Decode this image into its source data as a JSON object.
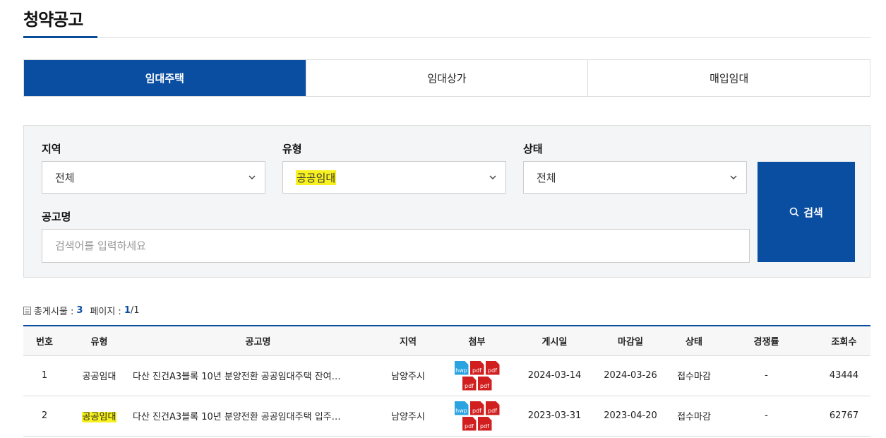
{
  "page": {
    "title": "청약공고"
  },
  "tabs": [
    {
      "label": "임대주택",
      "active": true
    },
    {
      "label": "임대상가",
      "active": false
    },
    {
      "label": "매입임대",
      "active": false
    }
  ],
  "filters": {
    "region": {
      "label": "지역",
      "value": "전체"
    },
    "type": {
      "label": "유형",
      "value": "공공임대"
    },
    "status": {
      "label": "상태",
      "value": "전체"
    },
    "name": {
      "label": "공고명",
      "placeholder": "검색어를 입력하세요"
    },
    "search_label": "검색"
  },
  "summary": {
    "total_label": "총게시물 :",
    "total": "3",
    "page_label": "페이지 :",
    "page_current": "1",
    "page_total": "/1"
  },
  "table": {
    "headers": [
      "번호",
      "유형",
      "공고명",
      "지역",
      "첨부",
      "게시일",
      "마감일",
      "상태",
      "경쟁률",
      "조회수"
    ],
    "rows": [
      {
        "no": "1",
        "type": "공공임대",
        "title": "다산 진건A3블록 10년 분양전환 공공임대주택 잔여…",
        "region": "남양주시",
        "files": [
          "hwp",
          "pdf",
          "pdf",
          "pdf",
          "pdf"
        ],
        "posted": "2024-03-14",
        "deadline": "2024-03-26",
        "status": "접수마감",
        "rate": "-",
        "views": "43444"
      },
      {
        "no": "2",
        "type": "공공임대",
        "title": "다산 진건A3블록 10년 분양전환 공공임대주택 입주…",
        "region": "남양주시",
        "files": [
          "hwp",
          "pdf",
          "pdf",
          "pdf",
          "pdf"
        ],
        "posted": "2023-03-31",
        "deadline": "2023-04-20",
        "status": "접수마감",
        "rate": "-",
        "views": "62767"
      }
    ]
  },
  "colors": {
    "primary": "#0a4ea2",
    "highlight": "#f7f21f",
    "hwp": "#2aa3e0",
    "pdf": "#d11f1f"
  }
}
